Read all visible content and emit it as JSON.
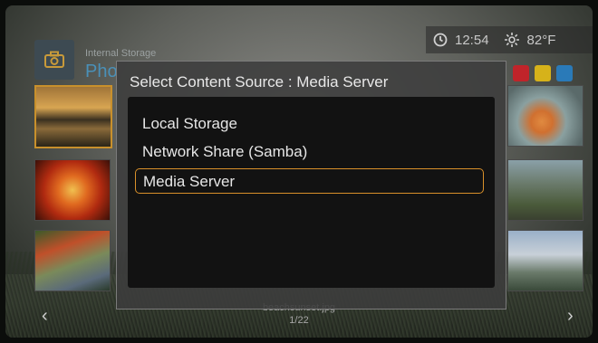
{
  "header": {
    "subtitle": "Internal Storage",
    "title": "Pho"
  },
  "status": {
    "time": "12:54",
    "temperature": "82°F"
  },
  "colors": {
    "red": "#c0242a",
    "yellow": "#d6b21a",
    "blue": "#2a7ab8",
    "green": "#3aa845",
    "accent": "#d9902a"
  },
  "dialog": {
    "title": "Select Content Source : Media Server",
    "options": [
      "Local Storage",
      "Network Share (Samba)",
      "Media Server"
    ],
    "selected_index": 2
  },
  "footer": {
    "filename": "beachsunset.jpg",
    "count": "1/22"
  }
}
